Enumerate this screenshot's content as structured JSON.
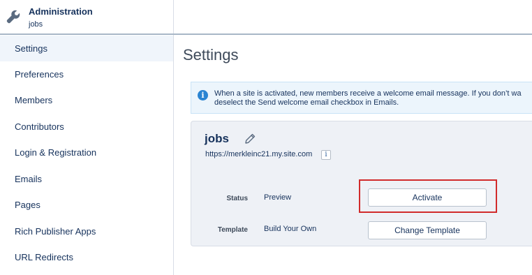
{
  "header": {
    "title": "Administration",
    "subtitle": "jobs",
    "icon": "wrench-icon"
  },
  "sidebar": {
    "items": [
      {
        "label": "Settings",
        "active": true
      },
      {
        "label": "Preferences",
        "active": false
      },
      {
        "label": "Members",
        "active": false
      },
      {
        "label": "Contributors",
        "active": false
      },
      {
        "label": "Login & Registration",
        "active": false
      },
      {
        "label": "Emails",
        "active": false
      },
      {
        "label": "Pages",
        "active": false
      },
      {
        "label": "Rich Publisher Apps",
        "active": false
      },
      {
        "label": "URL Redirects",
        "active": false
      }
    ]
  },
  "main": {
    "title": "Settings",
    "info": {
      "line1": "When a site is activated, new members receive a welcome email message. If you don’t wa",
      "line2": "deselect the Send welcome email checkbox in Emails."
    },
    "site": {
      "name": "jobs",
      "url": "https://merkleinc21.my.site.com",
      "url_info_glyph": "i",
      "status_label": "Status",
      "status_value": "Preview",
      "activate_label": "Activate",
      "template_label": "Template",
      "template_value": "Build Your Own",
      "change_template_label": "Change Template"
    }
  },
  "colors": {
    "highlight": "#d12b2b",
    "info_icon": "#2a84d2",
    "text": "#16325c"
  }
}
